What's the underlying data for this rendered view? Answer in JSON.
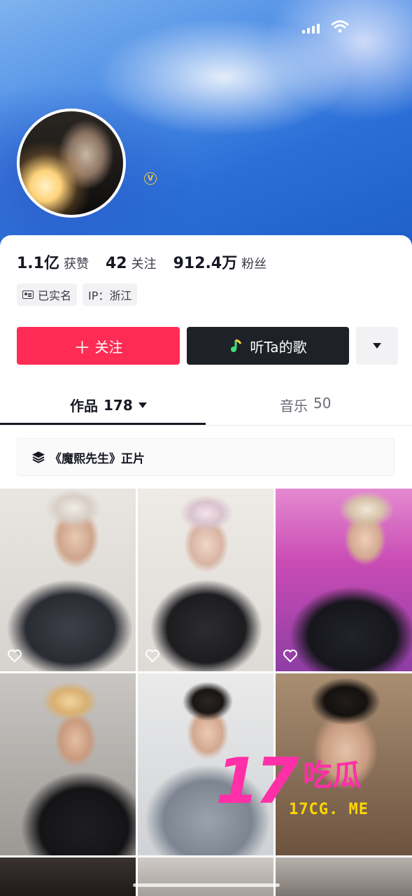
{
  "stats": {
    "likes_value": "1.1亿",
    "likes_label": "获赞",
    "following_value": "42",
    "following_label": "关注",
    "followers_value": "912.4万",
    "followers_label": "粉丝"
  },
  "tags": {
    "verified_label": "已实名",
    "ip_label": "IP：浙江"
  },
  "actions": {
    "follow_plus": "＋",
    "follow_label": "关注",
    "music_label": "听Ta的歌"
  },
  "tabs": {
    "works_label": "作品",
    "works_count": "178",
    "music_label": "音乐",
    "music_count": "50"
  },
  "collection": {
    "label": "《魔熙先生》正片"
  },
  "watermark": {
    "number": "17",
    "text": "吃瓜",
    "url": "17CG. ME"
  },
  "colors": {
    "accent_follow": "#fe2c55",
    "music_button": "#1f2128",
    "watermark_pink": "#ff2fa8",
    "watermark_yellow": "#ffd700"
  }
}
